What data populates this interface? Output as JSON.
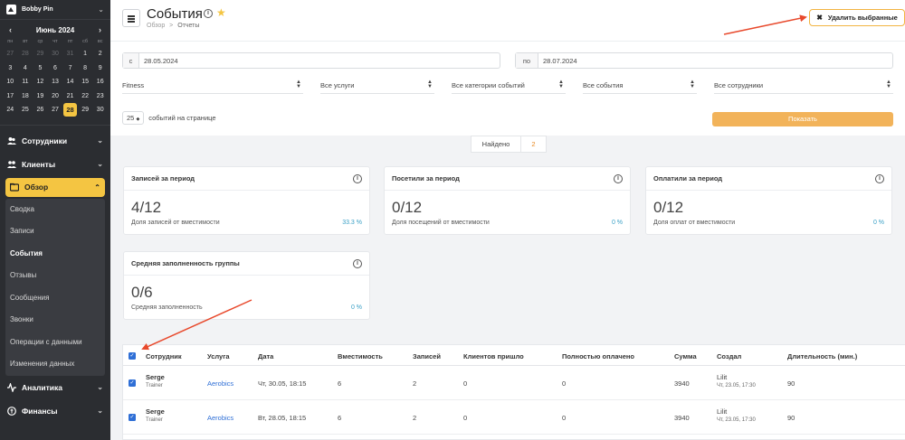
{
  "sidebar": {
    "user": "Bobby Pin",
    "calendar": {
      "month": "Июнь 2024",
      "prev": "‹",
      "next": "›",
      "weekdays": [
        "пн",
        "вт",
        "ср",
        "чт",
        "пт",
        "сб",
        "вс"
      ],
      "days": [
        {
          "d": "27",
          "m": true
        },
        {
          "d": "28",
          "m": true
        },
        {
          "d": "29",
          "m": true
        },
        {
          "d": "30",
          "m": true
        },
        {
          "d": "31",
          "m": true
        },
        {
          "d": "1"
        },
        {
          "d": "2"
        },
        {
          "d": "3"
        },
        {
          "d": "4"
        },
        {
          "d": "5"
        },
        {
          "d": "6"
        },
        {
          "d": "7"
        },
        {
          "d": "8"
        },
        {
          "d": "9"
        },
        {
          "d": "10"
        },
        {
          "d": "11"
        },
        {
          "d": "12"
        },
        {
          "d": "13"
        },
        {
          "d": "14"
        },
        {
          "d": "15"
        },
        {
          "d": "16"
        },
        {
          "d": "17"
        },
        {
          "d": "18"
        },
        {
          "d": "19"
        },
        {
          "d": "20"
        },
        {
          "d": "21"
        },
        {
          "d": "22"
        },
        {
          "d": "23"
        },
        {
          "d": "24"
        },
        {
          "d": "25"
        },
        {
          "d": "26"
        },
        {
          "d": "27"
        },
        {
          "d": "28",
          "today": true
        },
        {
          "d": "29"
        },
        {
          "d": "30"
        }
      ]
    },
    "nav": {
      "employees": "Сотрудники",
      "clients": "Клиенты",
      "overview": "Обзор",
      "analytics": "Аналитика",
      "finance": "Финансы"
    },
    "sub_items": [
      "Сводка",
      "Записи",
      "События",
      "Отзывы",
      "Сообщения",
      "Звонки",
      "Операции с данными",
      "Изменения данных"
    ],
    "current_sub": "События"
  },
  "header": {
    "title": "События",
    "breadcrumb_root": "Обзор",
    "breadcrumb_sep": ">",
    "breadcrumb_current": "Отчеты",
    "delete_label": "Удалить выбранные"
  },
  "filters": {
    "from_label": "с",
    "from_value": "28.05.2024",
    "to_label": "по",
    "to_value": "28.07.2024",
    "selects": [
      "Fitness",
      "Все услуги",
      "Все категории событий",
      "Все события",
      "Все сотрудники"
    ],
    "per_page_value": "25",
    "per_page_label": "событий на странице",
    "show_label": "Показать"
  },
  "found": {
    "label": "Найдено",
    "value": "2"
  },
  "stats": [
    {
      "title": "Записей за период",
      "big": "4/12",
      "sub": "Доля записей от вместимости",
      "pct": "33.3 %"
    },
    {
      "title": "Посетили за период",
      "big": "0/12",
      "sub": "Доля посещений от вместимости",
      "pct": "0 %"
    },
    {
      "title": "Оплатили за период",
      "big": "0/12",
      "sub": "Доля оплат от вместимости",
      "pct": "0 %"
    },
    {
      "title": "Средняя заполненность группы",
      "big": "0/6",
      "sub": "Средняя заполненность",
      "pct": "0 %"
    }
  ],
  "table": {
    "headers": [
      "Сотрудник",
      "Услуга",
      "Дата",
      "Вместимость",
      "Записей",
      "Клиентов пришло",
      "Полностью оплачено",
      "Сумма",
      "Создал",
      "Длительность (мин.)"
    ],
    "rows": [
      {
        "name": "Serge",
        "role": "Trainer",
        "service": "Aerobics",
        "date": "Чт, 30.05, 18:15",
        "capacity": "6",
        "records": "2",
        "came": "0",
        "paid": "0",
        "sum": "3940",
        "creator": "Lilit",
        "created": "Чт, 23.05, 17:30",
        "duration": "90"
      },
      {
        "name": "Serge",
        "role": "Trainer",
        "service": "Aerobics",
        "date": "Вт, 28.05, 18:15",
        "capacity": "6",
        "records": "2",
        "came": "0",
        "paid": "0",
        "sum": "3940",
        "creator": "Lilit",
        "created": "Чт, 23.05, 17:30",
        "duration": "90"
      }
    ]
  },
  "colors": {
    "accent": "#f4c542",
    "button": "#f2b35a",
    "link": "#2f6fd6",
    "arrow": "#e8492c"
  }
}
